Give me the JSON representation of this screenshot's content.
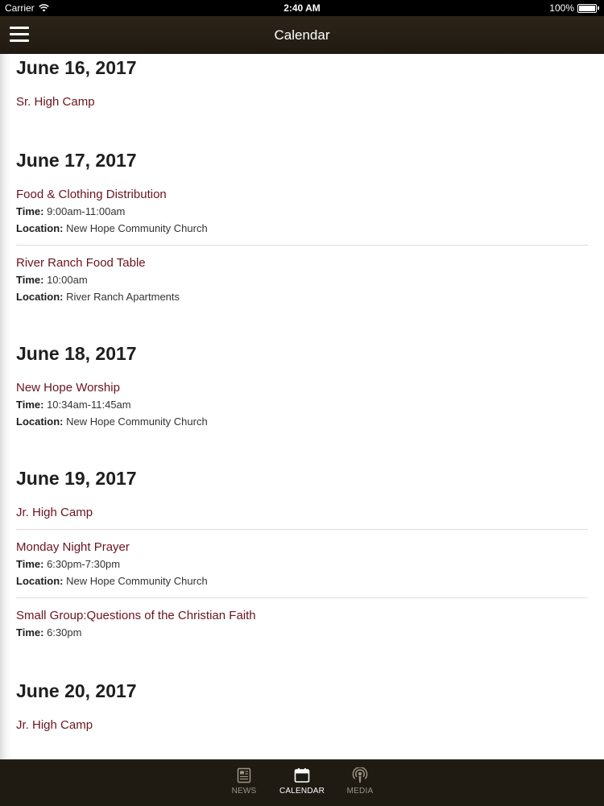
{
  "status_bar": {
    "carrier": "Carrier",
    "time": "2:40 AM",
    "battery": "100%"
  },
  "nav": {
    "title": "Calendar"
  },
  "days": [
    {
      "date": "June 16, 2017",
      "events": [
        {
          "title": "Sr. High Camp"
        }
      ]
    },
    {
      "date": "June 17, 2017",
      "events": [
        {
          "title": "Food & Clothing Distribution",
          "time": "9:00am-11:00am",
          "location": "New Hope Community Church"
        },
        {
          "title": "River Ranch Food Table",
          "time": "10:00am",
          "location": "River Ranch Apartments"
        }
      ]
    },
    {
      "date": "June 18, 2017",
      "events": [
        {
          "title": "New Hope Worship",
          "time": "10:34am-11:45am",
          "location": "New Hope Community Church"
        }
      ]
    },
    {
      "date": "June 19, 2017",
      "events": [
        {
          "title": "Jr. High Camp"
        },
        {
          "title": "Monday Night Prayer",
          "time": "6:30pm-7:30pm",
          "location": "New Hope Community Church"
        },
        {
          "title": "Small Group:Questions of the Christian Faith",
          "time": "6:30pm"
        }
      ]
    },
    {
      "date": "June 20, 2017",
      "events": [
        {
          "title": "Jr. High Camp"
        }
      ]
    }
  ],
  "labels": {
    "time": "Time:",
    "location": "Location:"
  },
  "tabs": [
    {
      "label": "NEWS",
      "icon": "news-icon",
      "active": false
    },
    {
      "label": "CALENDAR",
      "icon": "calendar-icon",
      "active": true
    },
    {
      "label": "MEDIA",
      "icon": "podcast-icon",
      "active": false
    }
  ],
  "colors": {
    "accent": "#6b1320",
    "bar": "#1f1a12"
  }
}
